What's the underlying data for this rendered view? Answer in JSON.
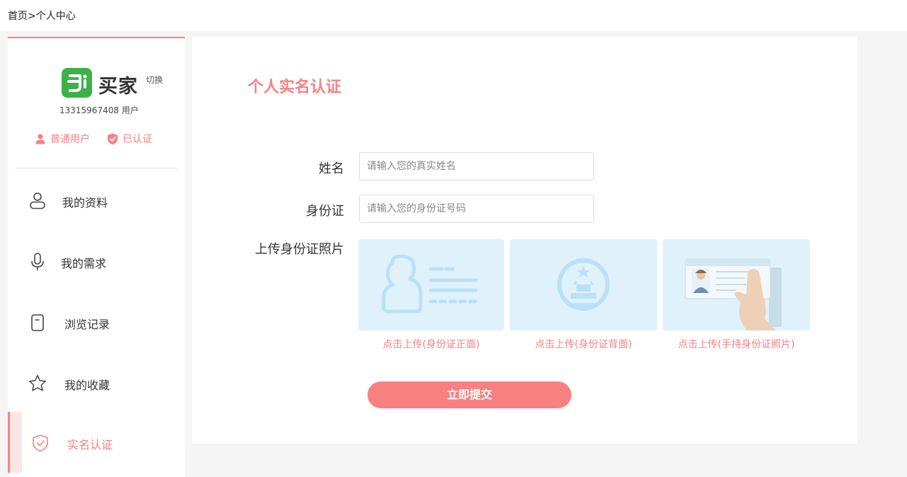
{
  "breadcrumb": {
    "home": "首页",
    "separator": ">",
    "current": "个人中心"
  },
  "sidebar": {
    "brand_name": "买家",
    "switch_label": "切换",
    "phone": "13315967408",
    "role": "用户",
    "badge_user": "普通用户",
    "badge_verified": "已认证",
    "menu": [
      {
        "label": "我的资料",
        "icon": "user-outline-icon"
      },
      {
        "label": "我的需求",
        "icon": "microphone-icon"
      },
      {
        "label": "浏览记录",
        "icon": "document-icon"
      },
      {
        "label": "我的收藏",
        "icon": "star-icon"
      },
      {
        "label": "实名认证",
        "icon": "shield-check-icon",
        "active": true
      }
    ]
  },
  "main": {
    "title": "个人实名认证",
    "name_label": "姓名",
    "name_placeholder": "请输入您的真实姓名",
    "id_label": "身份证",
    "id_placeholder": "请输入您的身份证号码",
    "upload_label": "上传身份证照片",
    "uploads": [
      {
        "caption": "点击上传(身份证正面)"
      },
      {
        "caption": "点击上传(身份证背面)"
      },
      {
        "caption": "点击上传(手持身份证照片)"
      }
    ],
    "submit_label": "立即提交"
  },
  "colors": {
    "accent": "#f98081",
    "brand_green": "#3cb14a",
    "upload_bg": "#dff1fb"
  }
}
